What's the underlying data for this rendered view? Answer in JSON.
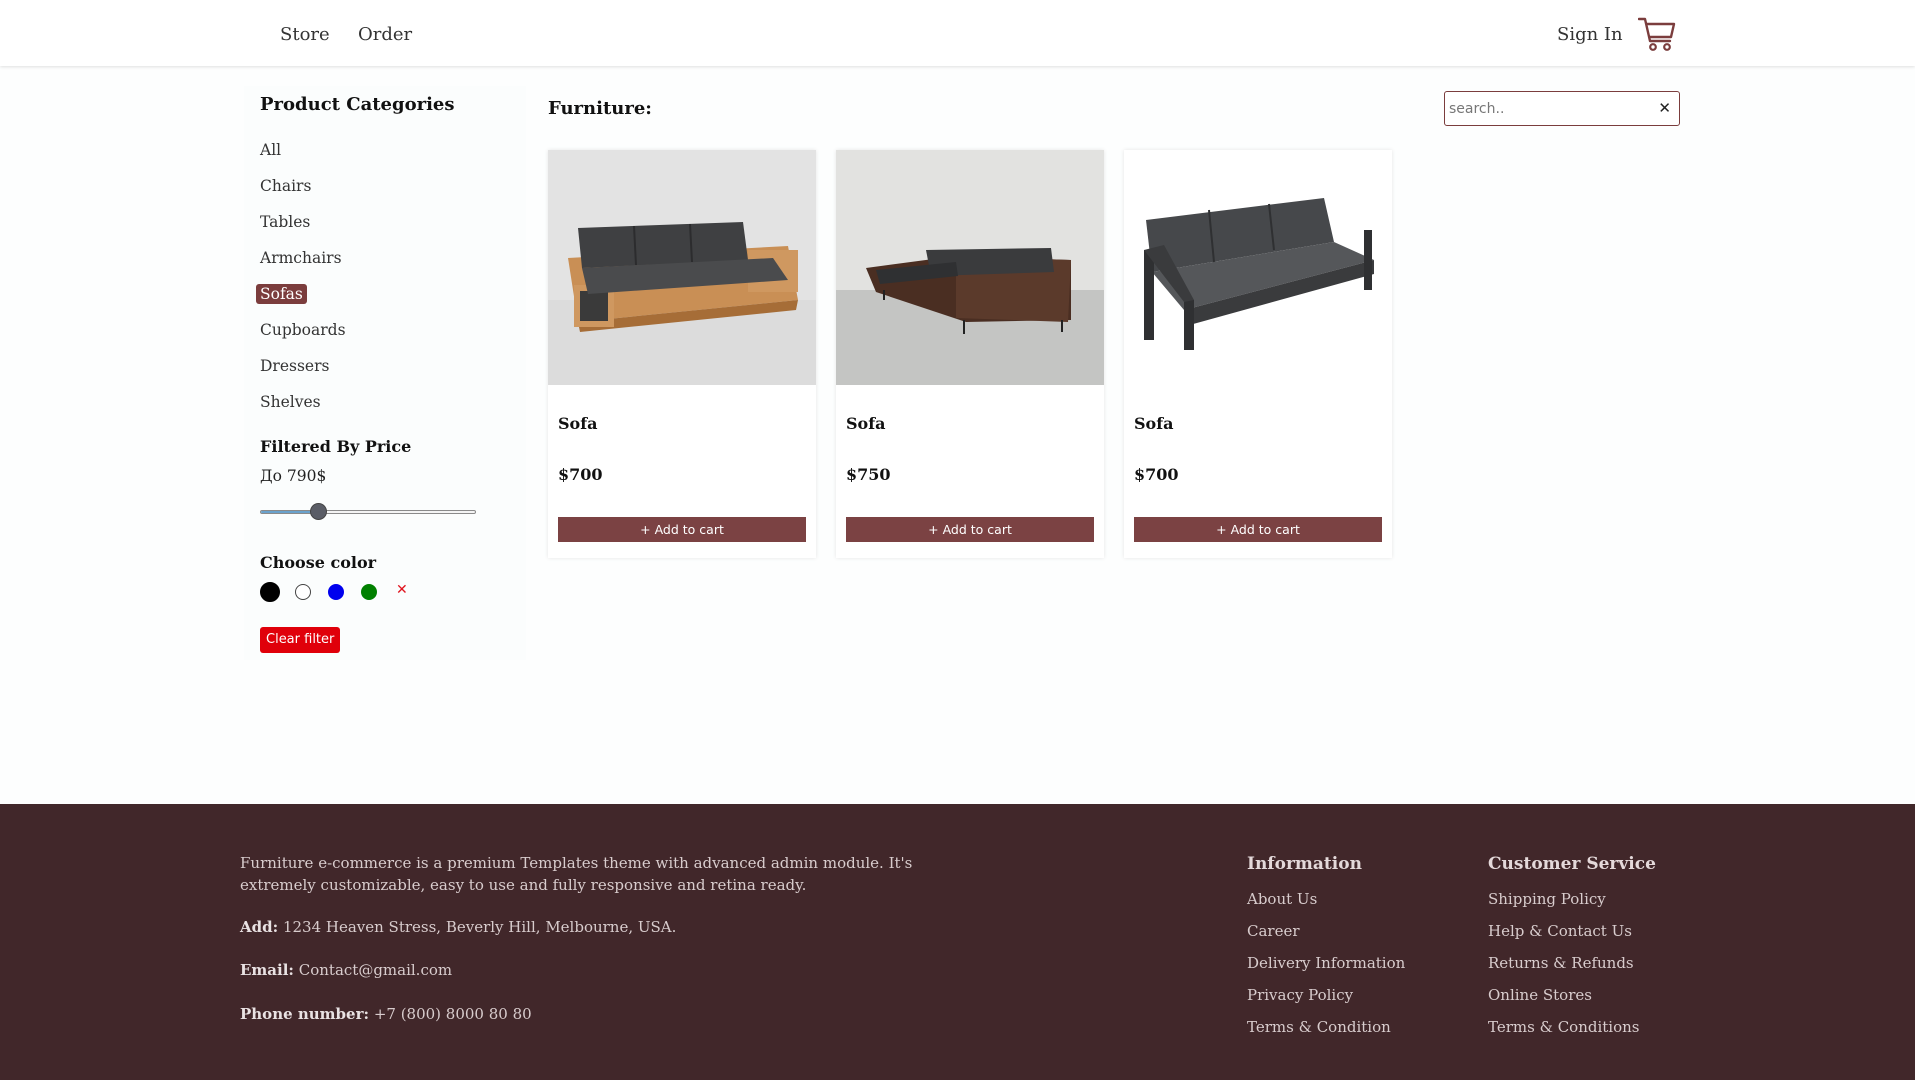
{
  "nav": {
    "store_label": "Store",
    "order_label": "Order",
    "signin_label": "Sign In",
    "cart_icon": "shopping-cart-icon"
  },
  "sidebar": {
    "title": "Product Categories",
    "categories": [
      "All",
      "Chairs",
      "Tables",
      "Armchairs",
      "Sofas",
      "Cupboards",
      "Dressers",
      "Shelves"
    ],
    "active_category": "Sofas",
    "price_filter_title": "Filtered By Price",
    "price_label": "До 790$",
    "price_slider_fraction": 0.27,
    "color_title": "Choose color",
    "colors": [
      "#000000",
      "#ffffff",
      "#0000ee",
      "#008000"
    ],
    "color_clear_icon": "x-icon",
    "clear_filter_label": "Clear filter"
  },
  "main": {
    "section_title": "Furniture:",
    "search": {
      "placeholder": "search..",
      "value": ""
    },
    "products": [
      {
        "name": "Sofa",
        "price": "$700",
        "button": "+ Add to cart"
      },
      {
        "name": "Sofa",
        "price": "$750",
        "button": "+ Add to cart"
      },
      {
        "name": "Sofa",
        "price": "$700",
        "button": "+ Add to cart"
      }
    ]
  },
  "footer": {
    "description": "Furniture e-commerce is a premium Templates theme with advanced admin module. It's extremely customizable, easy to use and fully responsive and retina ready.",
    "address_label": "Add:",
    "address_value": "1234 Heaven Stress, Beverly Hill, Melbourne, USA.",
    "email_label": "Email:",
    "email_value": "Contact@gmail.com",
    "phone_label": "Phone number:",
    "phone_value": "+7 (800) 8000 80 80",
    "information": {
      "title": "Information",
      "links": [
        "About Us",
        "Career",
        "Delivery Information",
        "Privacy Policy",
        "Terms & Condition"
      ]
    },
    "customer_service": {
      "title": "Customer Service",
      "links": [
        "Shipping Policy",
        "Help & Contact Us",
        "Returns & Refunds",
        "Online Stores",
        "Terms & Conditions"
      ]
    }
  }
}
